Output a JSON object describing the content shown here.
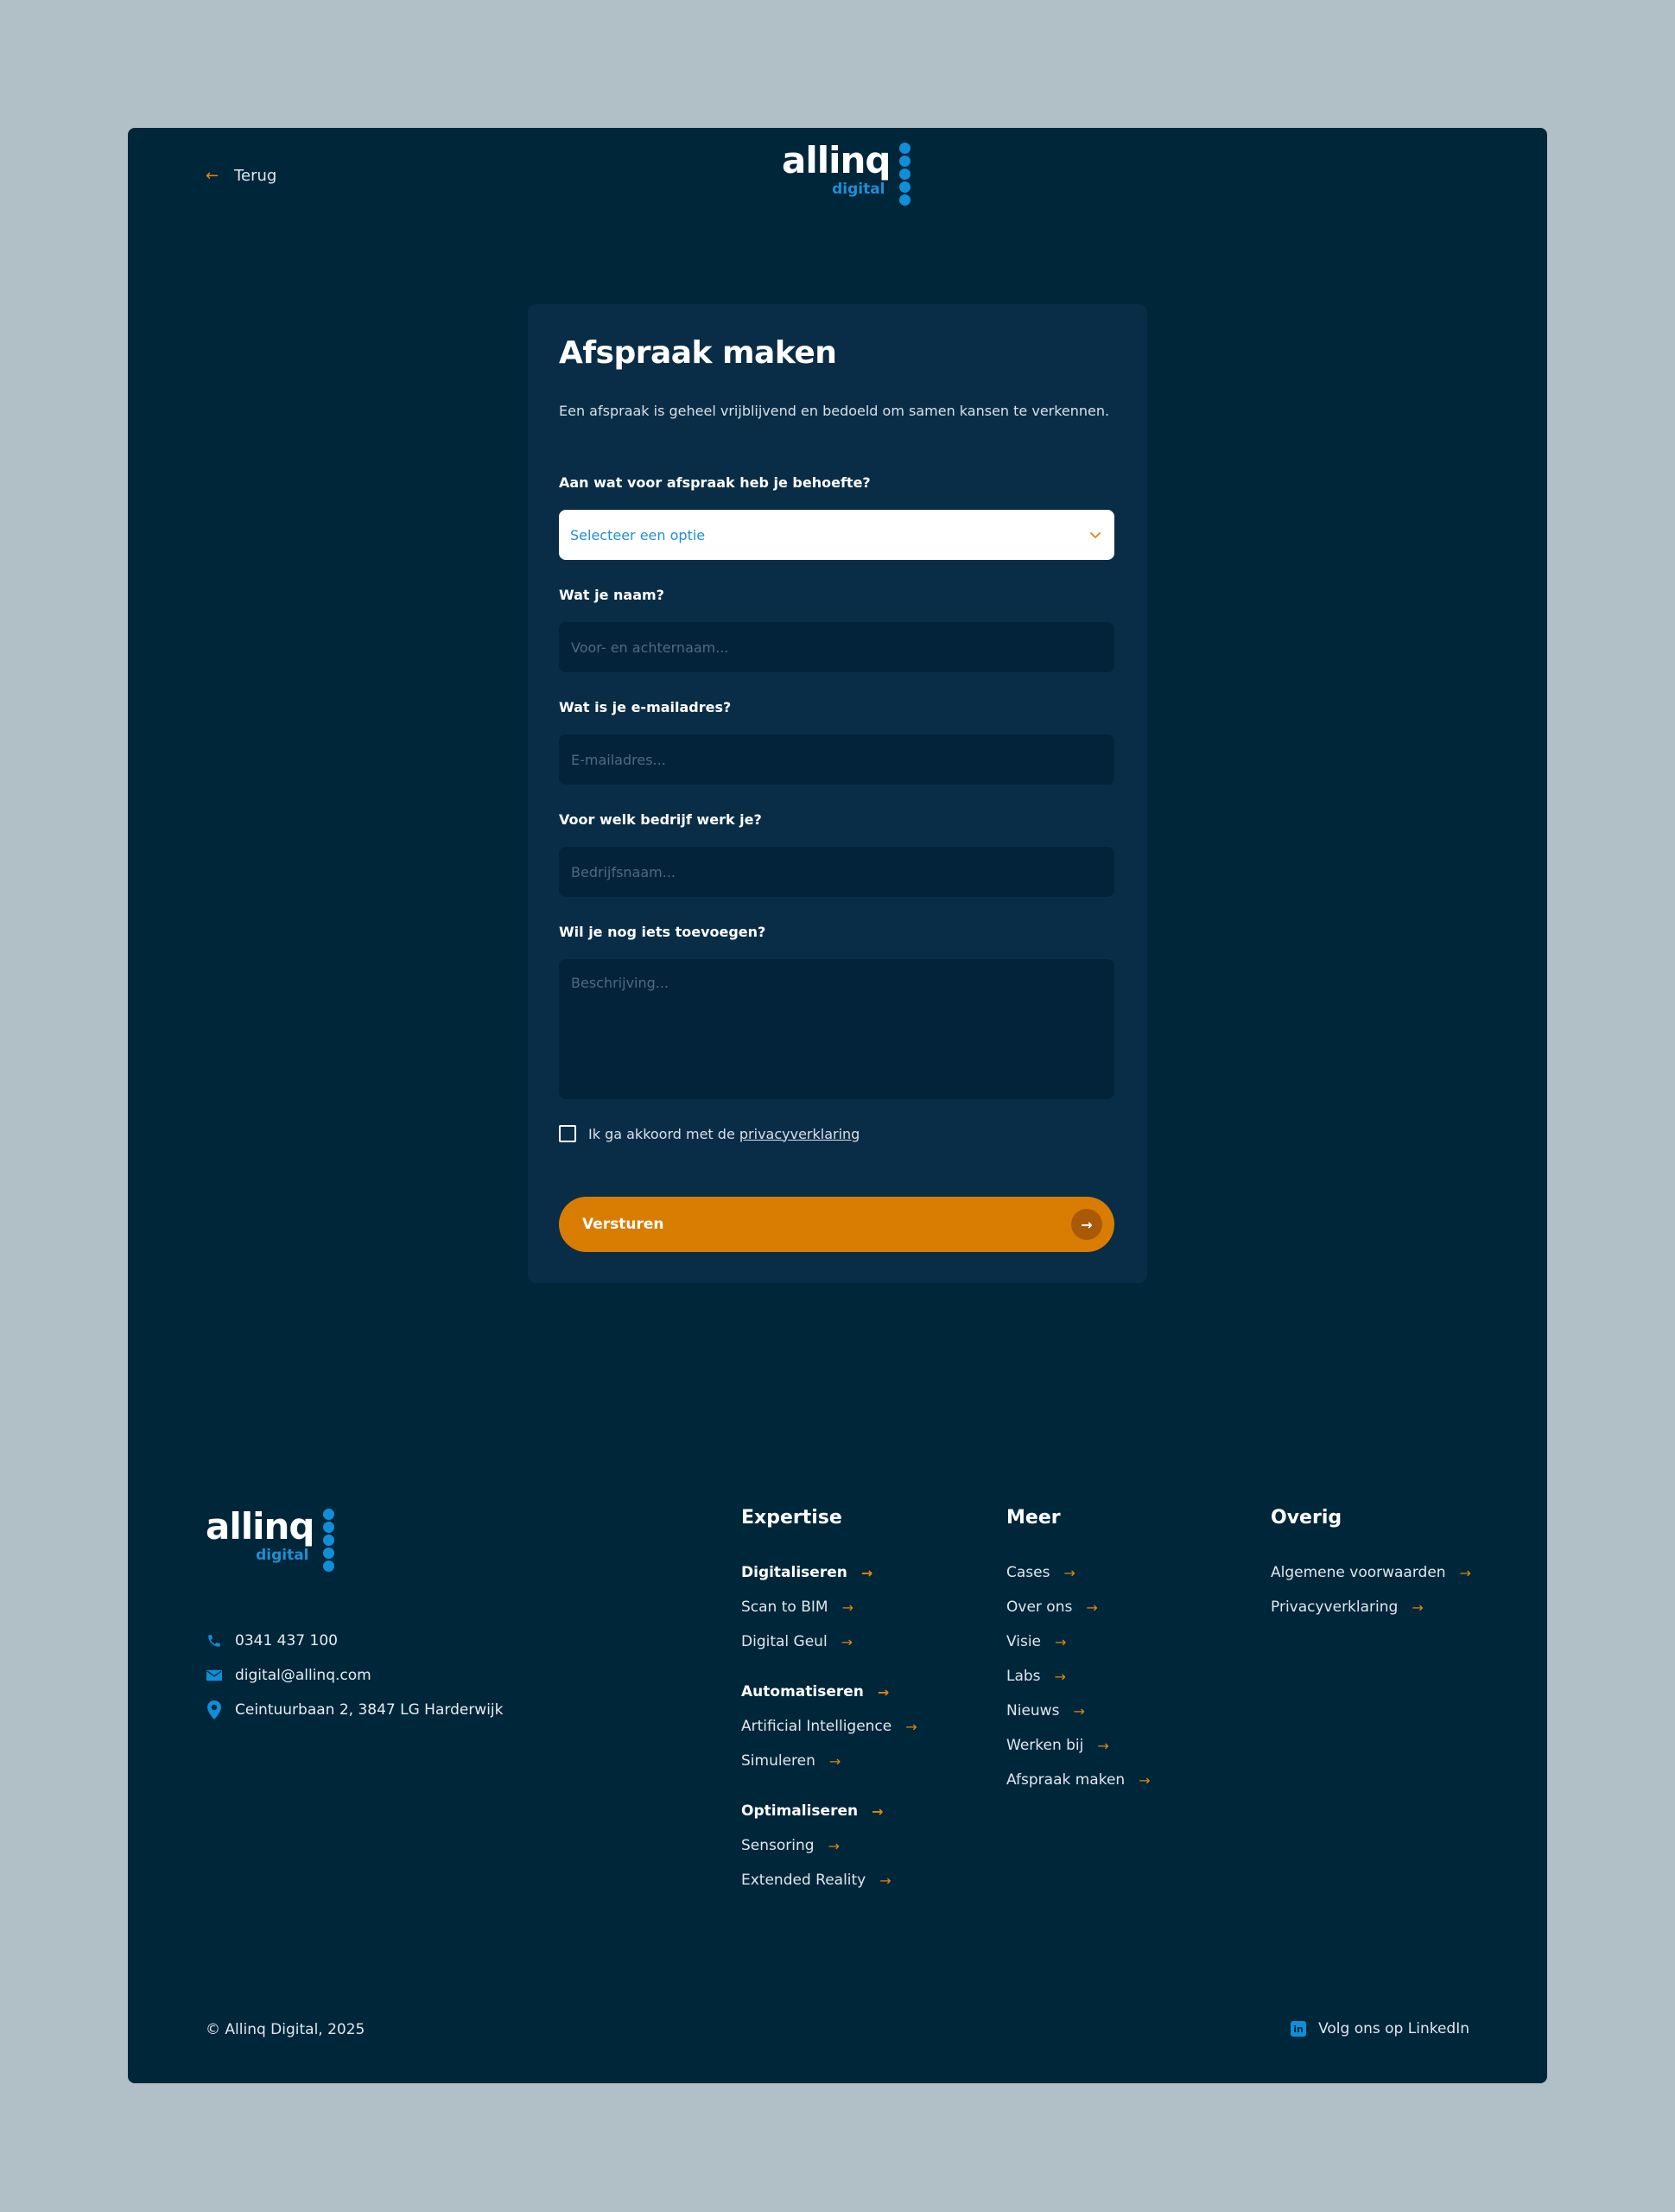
{
  "header": {
    "back_label": "Terug",
    "logo": {
      "brand": "allinq",
      "sub": "digital"
    }
  },
  "form": {
    "title": "Afspraak maken",
    "intro": "Een afspraak is geheel vrijblijvend en bedoeld om samen kansen te verkennen.",
    "type_label": "Aan wat voor afspraak heb je behoefte?",
    "type_value": "Selecteer een optie",
    "name_label": "Wat je naam?",
    "name_placeholder": "Voor- en achternaam...",
    "email_label": "Wat is je e-mailadres?",
    "email_placeholder": "E-mailadres...",
    "company_label": "Voor welk bedrijf werk je?",
    "company_placeholder": "Bedrijfsnaam...",
    "extra_label": "Wil je nog iets toevoegen?",
    "extra_placeholder": "Beschrijving...",
    "consent_text": "Ik ga akkoord met de",
    "consent_link": "privacyverklaring",
    "submit_label": "Versturen"
  },
  "footer": {
    "logo": {
      "brand": "allinq",
      "sub": "digital"
    },
    "contact": {
      "phone": "0341 437 100",
      "email": "digital@allinq.com",
      "address": "Ceintuurbaan 2, 3847 LG Harderwijk"
    },
    "expertise": {
      "title": "Expertise",
      "groups": [
        {
          "head": "Digitaliseren",
          "items": [
            "Scan to BIM",
            "Digital Geul"
          ]
        },
        {
          "head": "Automatiseren",
          "items": [
            "Artificial Intelligence",
            "Simuleren"
          ]
        },
        {
          "head": "Optimaliseren",
          "items": [
            "Sensoring",
            "Extended Reality"
          ]
        }
      ]
    },
    "meer": {
      "title": "Meer",
      "items": [
        "Cases",
        "Over ons",
        "Visie",
        "Labs",
        "Nieuws",
        "Werken bij",
        "Afspraak maken"
      ]
    },
    "overig": {
      "title": "Overig",
      "items": [
        "Algemene voorwaarden",
        "Privacyverklaring"
      ]
    },
    "copyright": "© Allinq Digital, 2025",
    "linkedin_label": "Volg ons op LinkedIn",
    "linkedin_badge": "in"
  },
  "colors": {
    "background": "#b1c0c6",
    "frame": "#00263a",
    "card": "#0a2d47",
    "accent": "#d97d02",
    "brand_blue": "#0f8fd8"
  },
  "icons": {
    "back": "arrow-left-icon",
    "dropdown": "chevron-down-icon",
    "submit": "arrow-right-icon",
    "phone": "phone-icon",
    "email": "mail-icon",
    "address": "location-pin-icon",
    "linkedin": "linkedin-icon"
  }
}
